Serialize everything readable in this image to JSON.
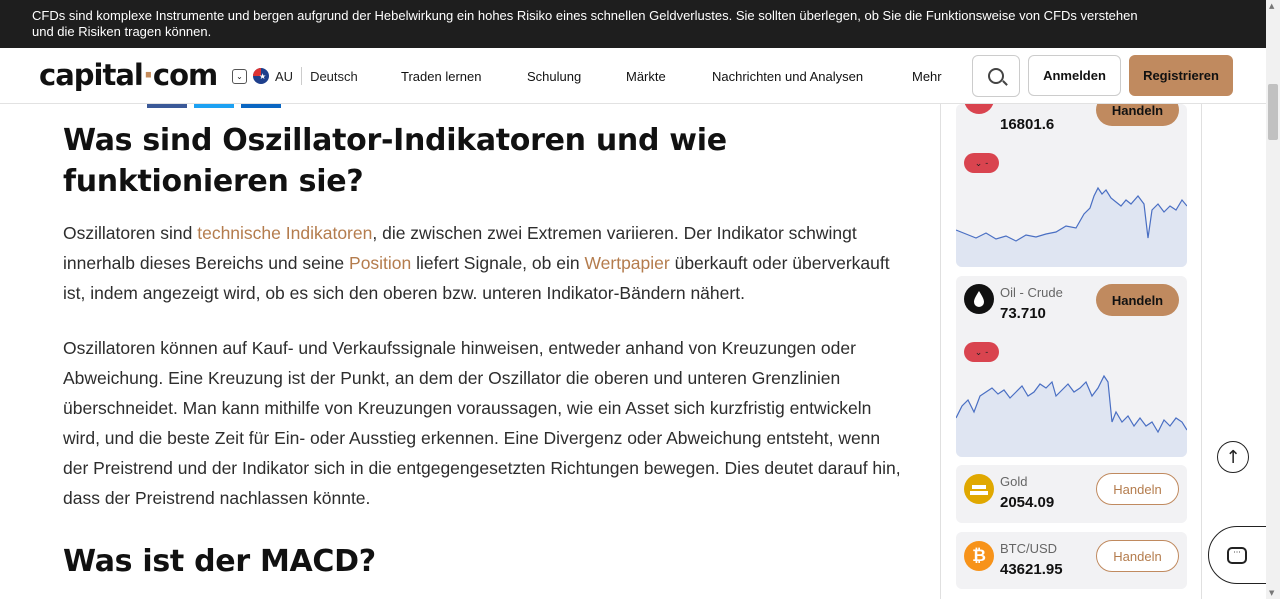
{
  "warning": {
    "text_line1": "CFDs sind komplexe Instrumente und bergen aufgrund der Hebelwirkung ein hohes Risiko eines schnellen Geldverlustes. Sie sollten überlegen, ob Sie die Funktionsweise von CFDs verstehen",
    "text_line2": "und die Risiken tragen können."
  },
  "header": {
    "logo_left": "capital",
    "logo_dot": "·",
    "logo_right": "com",
    "region": "AU",
    "language": "Deutsch",
    "nav": [
      "Traden lernen",
      "Schulung",
      "Märkte",
      "Nachrichten und Analysen",
      "Mehr"
    ],
    "login": "Anmelden",
    "register": "Registrieren"
  },
  "article": {
    "heading1": "Was sind Oszillator-Indikatoren und wie funktionieren sie?",
    "p1": {
      "s1": "Oszillatoren sind ",
      "l1": "technische Indikatoren",
      "s2": ", die zwischen zwei Extremen variieren. Der Indikator schwingt innerhalb dieses Bereichs und seine ",
      "l2": "Position",
      "s3": " liefert Signale, ob ein ",
      "l3": "Wertpapier",
      "s4": " überkauft oder überverkauft ist, indem angezeigt wird, ob es sich den oberen bzw. unteren Indikator-Bändern nähert."
    },
    "p2": "Oszillatoren können auf Kauf- und Verkaufssignale hinweisen, entweder anhand von Kreuzungen oder Abweichung. Eine Kreuzung ist der Punkt, an dem der Oszillator die oberen und unteren Grenzlinien überschneidet. Man kann mithilfe von Kreuzungen voraussagen, wie ein Asset sich kurzfristig entwickeln wird, und die beste Zeit für Ein- oder Ausstieg erkennen. Eine Divergenz oder Abweichung entsteht, wenn der Preistrend und der Indikator sich in die entgegengesetzten Richtungen bewegen. Dies deutet darauf hin, dass der Preistrend nachlassen könnte.",
    "heading2": "Was ist der MACD?"
  },
  "sidebar": {
    "cards": [
      {
        "name": "",
        "price": "16801.6",
        "change": "-",
        "button": "Handeln"
      },
      {
        "name": "Oil - Crude",
        "price": "73.710",
        "change": "-",
        "button": "Handeln"
      },
      {
        "name": "Gold",
        "price": "2054.09",
        "button": "Handeln"
      },
      {
        "name": "BTC/USD",
        "price": "43621.95",
        "button": "Handeln"
      }
    ],
    "bitcoin_symbol": "₿",
    "change_arrow": "⌄"
  },
  "colors": {
    "accent": "#c08a5f",
    "link": "#b47c4d",
    "negative": "#d9444f",
    "warning_bg": "#1e1e1e"
  },
  "icons": {
    "back_to_top": "↑"
  }
}
